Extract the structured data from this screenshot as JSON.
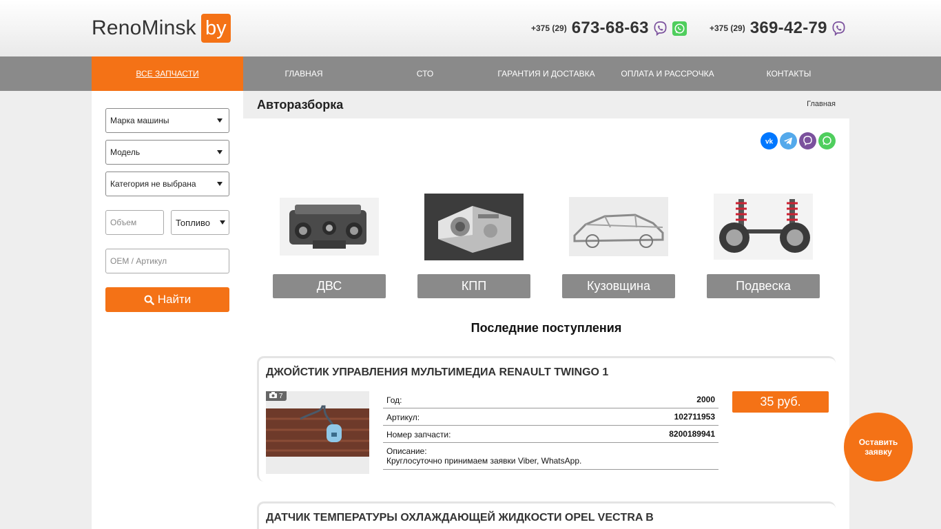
{
  "header": {
    "logo_text": "RenoMinsk",
    "logo_badge": "by",
    "phones": [
      {
        "code": "+375 (29)",
        "number": "673-68-63",
        "messengers": [
          "viber-icon",
          "whatsapp-icon"
        ]
      },
      {
        "code": "+375 (29)",
        "number": "369-42-79",
        "messengers": [
          "viber-icon"
        ]
      }
    ]
  },
  "nav": {
    "items": [
      {
        "label": "Все запчасти",
        "active": true
      },
      {
        "label": "Главная"
      },
      {
        "label": "СТО"
      },
      {
        "label": "Гарантия и доставка"
      },
      {
        "label": "Оплата и рассрочка"
      },
      {
        "label": "Контакты"
      }
    ]
  },
  "sidebar": {
    "make_select": "Марка машины",
    "model_select": "Модель",
    "category_select": "Категория не выбрана",
    "volume_placeholder": "Объем",
    "fuel_select": "Топливо",
    "oem_placeholder": "OEM / Артикул",
    "search_button": "Найти"
  },
  "main": {
    "title": "Авторазборка",
    "breadcrumb": "Главная",
    "share_icons": [
      "vk-icon",
      "telegram-icon",
      "viber-icon",
      "whatsapp-icon"
    ],
    "categories": [
      {
        "label": "ДВС",
        "icon": "engine-image"
      },
      {
        "label": "КПП",
        "icon": "gearbox-image"
      },
      {
        "label": "Кузовщина",
        "icon": "car-body-image"
      },
      {
        "label": "Подвеска",
        "icon": "suspension-image"
      }
    ],
    "section_title": "Последние поступления",
    "items": [
      {
        "title": "ДЖОЙСТИК УПРАВЛЕНИЯ МУЛЬТИМЕДИА RENAULT TWINGO 1",
        "photo_count": "7",
        "specs": [
          {
            "key": "Год:",
            "value": "2000"
          },
          {
            "key": "Артикул:",
            "value": "102711953"
          },
          {
            "key": "Номер запчасти:",
            "value": "8200189941"
          }
        ],
        "description_label": "Описание:",
        "description": "Круглосуточно принимаем заявки Viber, WhatsApp.",
        "price": "35 руб."
      },
      {
        "title": "ДАТЧИК ТЕМПЕРАТУРЫ ОХЛАЖДАЮЩЕЙ ЖИДКОСТИ OPEL VECTRA B"
      }
    ]
  },
  "callback": {
    "line1": "Оставить",
    "line2": "заявку"
  },
  "colors": {
    "accent": "#f47216",
    "nav": "#8a8a8a",
    "viber": "#7b519d",
    "whatsapp": "#4fce5d",
    "vk": "#0077ff",
    "telegram": "#54a9eb"
  }
}
